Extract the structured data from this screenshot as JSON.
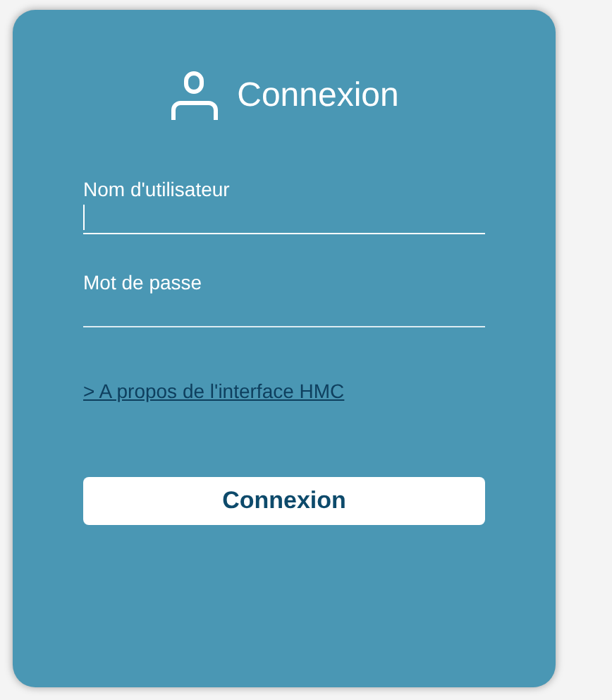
{
  "title": "Connexion",
  "fields": [
    {
      "label": "Nom d'utilisateur",
      "focused": true
    },
    {
      "label": "Mot de passe",
      "focused": false
    }
  ],
  "link": "> A propos de l'interface HMC",
  "button": "Connexion"
}
